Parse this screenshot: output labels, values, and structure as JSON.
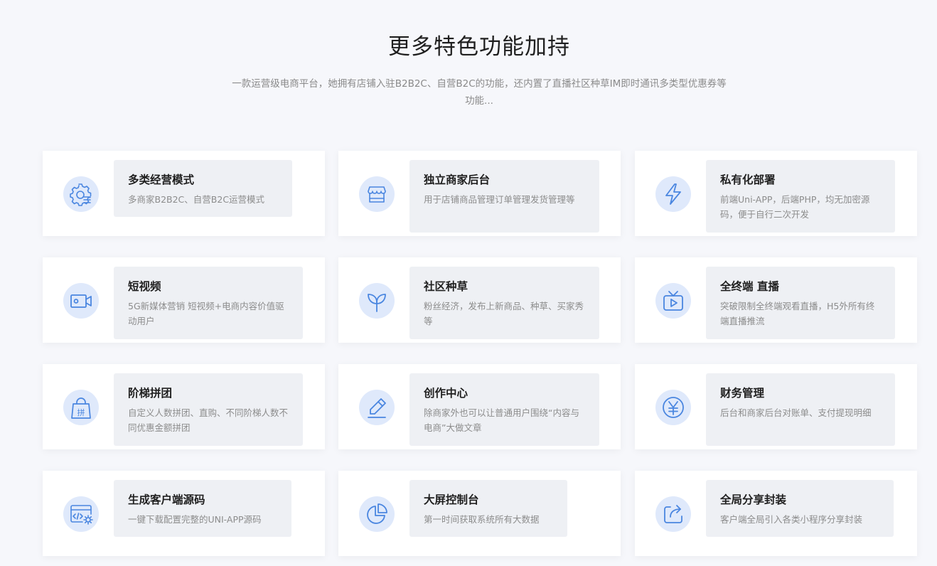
{
  "header": {
    "title": "更多特色功能加持",
    "subtitle": "一款运营级电商平台，她拥有店铺入驻B2B2C、自营B2C的功能，还内置了直播社区种草IM即时通讯多类型优惠券等功能..."
  },
  "accent_color": "#4a86e0",
  "features": [
    {
      "title": "多类经营模式",
      "desc": "多商家B2B2C、自营B2C运营模式",
      "icon": "gear-list-icon"
    },
    {
      "title": "独立商家后台",
      "desc": "用于店铺商品管理订单管理发货管理等",
      "icon": "store-icon"
    },
    {
      "title": "私有化部署",
      "desc": "前端Uni-APP，后端PHP，均无加密源码，便于自行二次开发",
      "icon": "lightning-icon"
    },
    {
      "title": "短视频",
      "desc": "5G新媒体营销 短视频+电商内容价值驱动用户",
      "icon": "video-camera-icon"
    },
    {
      "title": "社区种草",
      "desc": "粉丝经济，发布上新商品、种草、买家秀等",
      "icon": "sprout-icon"
    },
    {
      "title": "全终端 直播",
      "desc": "突破限制全终端观看直播，H5外所有终端直播推流",
      "icon": "tv-play-icon"
    },
    {
      "title": "阶梯拼团",
      "desc": "自定义人数拼团、直购、不同阶梯人数不同优惠金额拼团",
      "icon": "group-bag-icon"
    },
    {
      "title": "创作中心",
      "desc": "除商家外也可以让普通用户围绕“内容与电商”大做文章",
      "icon": "pencil-icon"
    },
    {
      "title": "财务管理",
      "desc": "后台和商家后台对账单、支付提现明细",
      "icon": "yen-icon"
    },
    {
      "title": "生成客户端源码",
      "desc": "一键下载配置完整的UNI-APP源码",
      "icon": "code-window-icon"
    },
    {
      "title": "大屏控制台",
      "desc": "第一时间获取系统所有大数据",
      "icon": "pie-chart-icon"
    },
    {
      "title": "全局分享封装",
      "desc": "客户端全局引入各类小程序分享封装",
      "icon": "share-icon"
    }
  ]
}
